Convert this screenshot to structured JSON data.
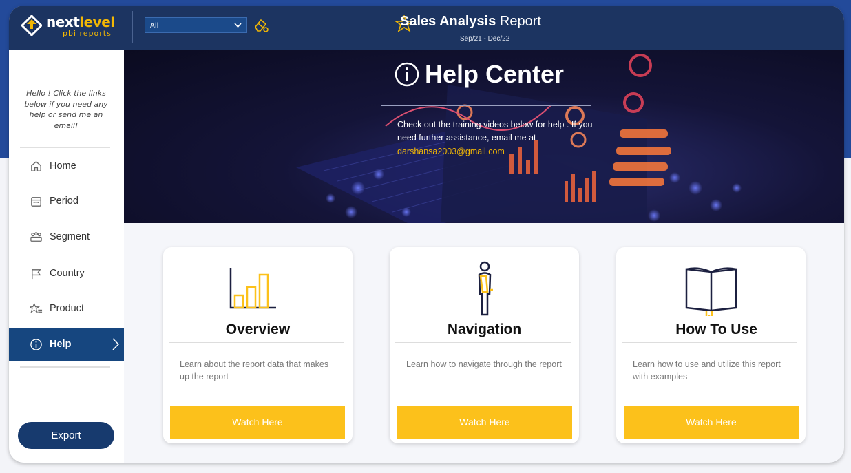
{
  "brand": {
    "word1": "next",
    "word2": "level",
    "tagline": "pbi reports"
  },
  "slicer": {
    "value": "All"
  },
  "header": {
    "title_bold": "Sales Analysis",
    "title_rest": " Report",
    "period": "Sep/21 - Dec/22"
  },
  "sidebar": {
    "greeting": "Hello ! Click the links below if you need any help or send me an email!",
    "items": [
      {
        "label": "Home",
        "icon": "home-icon"
      },
      {
        "label": "Period",
        "icon": "calendar-icon"
      },
      {
        "label": "Segment",
        "icon": "group-icon"
      },
      {
        "label": "Country",
        "icon": "flag-icon"
      },
      {
        "label": "Product",
        "icon": "star-list-icon"
      },
      {
        "label": "Help",
        "icon": "info-icon",
        "active": true
      }
    ],
    "export_label": "Export"
  },
  "banner": {
    "title": "Help Center",
    "text": "Check out the training videos below for help . If you need further assistance, email me at",
    "email": "darshansa2003@gmail.com"
  },
  "cards": [
    {
      "title": "Overview",
      "desc": "Learn about the report data that makes up the report",
      "button": "Watch Here",
      "icon": "bar-chart-icon"
    },
    {
      "title": "Navigation",
      "desc": "Learn how to navigate through the report",
      "button": "Watch Here",
      "icon": "person-icon"
    },
    {
      "title": "How To Use",
      "desc": "Learn how to use and utilize this report with examples",
      "button": "Watch Here",
      "icon": "book-icon"
    }
  ],
  "colors": {
    "header": "#1c3461",
    "accent": "#fcc11b",
    "active_nav": "#16467f"
  }
}
